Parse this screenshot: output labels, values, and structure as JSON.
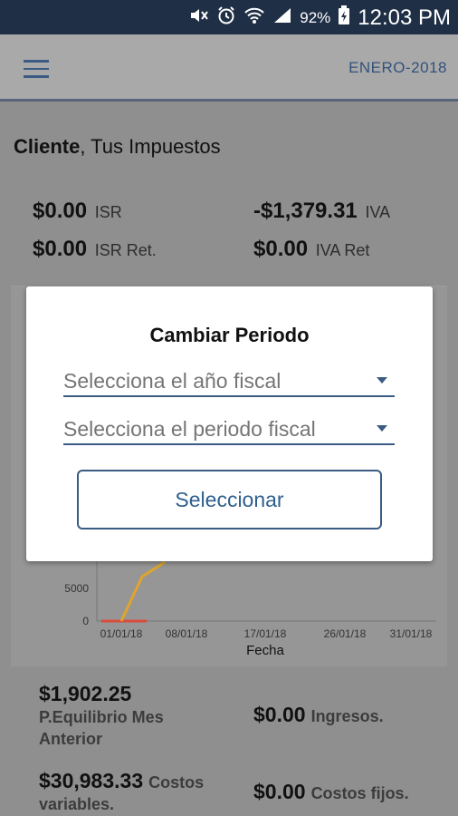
{
  "status_bar": {
    "battery": "92%",
    "time": "12:03 PM"
  },
  "app_bar": {
    "period": "ENERO-2018"
  },
  "greeting": {
    "name": "Cliente",
    "rest": ", Tus Impuestos"
  },
  "taxes": {
    "isr": {
      "value": "$0.00",
      "label": "ISR"
    },
    "iva": {
      "value": "-$1,379.31",
      "label": "IVA"
    },
    "isr_ret": {
      "value": "$0.00",
      "label": "ISR Ret."
    },
    "iva_ret": {
      "value": "$0.00",
      "label": "IVA Ret"
    }
  },
  "chart_data": {
    "type": "line",
    "xlabel": "Fecha",
    "categories": [
      "01/01/18",
      "08/01/18",
      "17/01/18",
      "26/01/18",
      "31/01/18"
    ],
    "y_ticks": [
      "0",
      "5000"
    ],
    "colors": {
      "series_orange": "#e0a52a",
      "series_red": "#d94b3d"
    }
  },
  "summary": {
    "equilibrio_value": "$1,902.25",
    "equilibrio_label": "P.Equilibrio Mes Anterior",
    "ingresos_value": "$0.00",
    "ingresos_label": "Ingresos.",
    "costos_var_value": "$30,983.33",
    "costos_var_label_a": "Costos",
    "costos_var_label_b": "variables.",
    "costos_fijos_value": "$0.00",
    "costos_fijos_label": "Costos fijos."
  },
  "dialog": {
    "title": "Cambiar Periodo",
    "year_placeholder": "Selecciona el año fiscal",
    "period_placeholder": "Selecciona el periodo fiscal",
    "button": "Seleccionar"
  },
  "colors": {
    "status_bar": "#1f2f45",
    "accent": "#3b5b83"
  }
}
